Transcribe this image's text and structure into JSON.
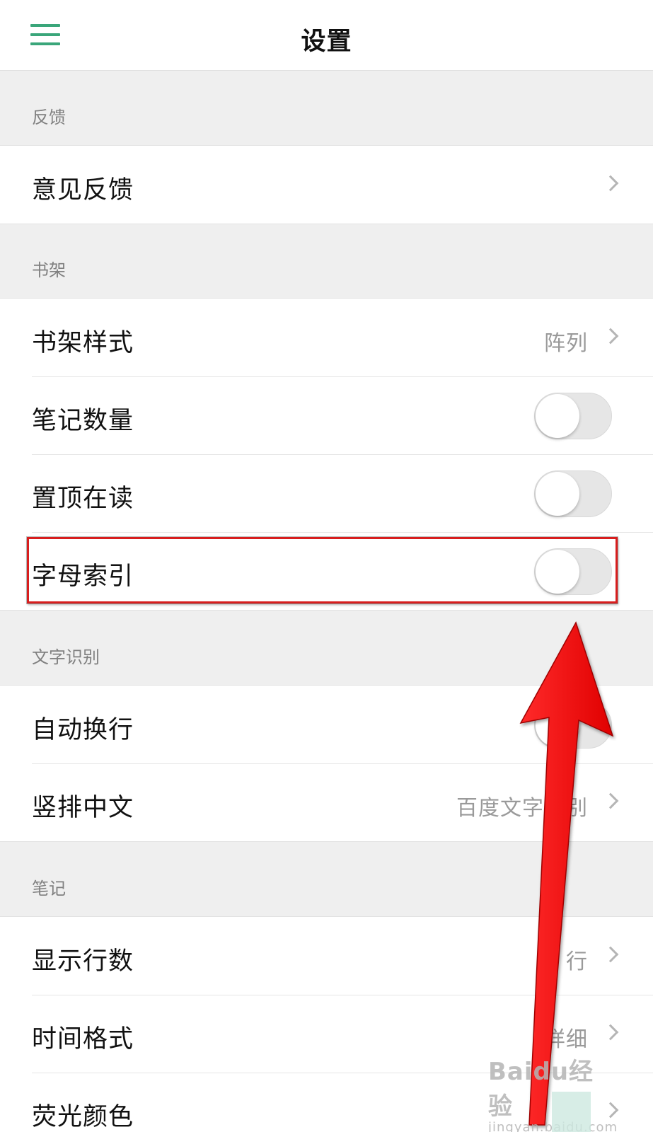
{
  "header": {
    "title": "设置",
    "menu_icon": "hamburger-menu-icon"
  },
  "sections": {
    "feedback": {
      "label": "反馈",
      "rows": [
        {
          "label": "意见反馈",
          "type": "link"
        }
      ]
    },
    "bookshelf": {
      "label": "书架",
      "rows": [
        {
          "label": "书架样式",
          "type": "link",
          "value": "阵列"
        },
        {
          "label": "笔记数量",
          "type": "toggle",
          "checked": false
        },
        {
          "label": "置顶在读",
          "type": "toggle",
          "checked": false
        },
        {
          "label": "字母索引",
          "type": "toggle",
          "checked": false
        }
      ]
    },
    "ocr": {
      "label": "文字识别",
      "rows": [
        {
          "label": "自动换行",
          "type": "toggle",
          "checked": false
        },
        {
          "label": "竖排中文",
          "type": "link",
          "value": "百度文字识别"
        }
      ]
    },
    "notes": {
      "label": "笔记",
      "rows": [
        {
          "label": "显示行数",
          "type": "link",
          "value": "3 行"
        },
        {
          "label": "时间格式",
          "type": "link",
          "value": "详细"
        },
        {
          "label": "荧光颜色",
          "type": "link"
        }
      ]
    }
  },
  "annotation": {
    "highlight_color": "#d81e1e",
    "arrow_color": "#ff0000"
  },
  "watermark": {
    "main": "Baidu经验",
    "sub": "jingyan.baidu.com"
  },
  "colors": {
    "accent": "#3aa67a",
    "background": "#efefef",
    "row": "#ffffff"
  }
}
